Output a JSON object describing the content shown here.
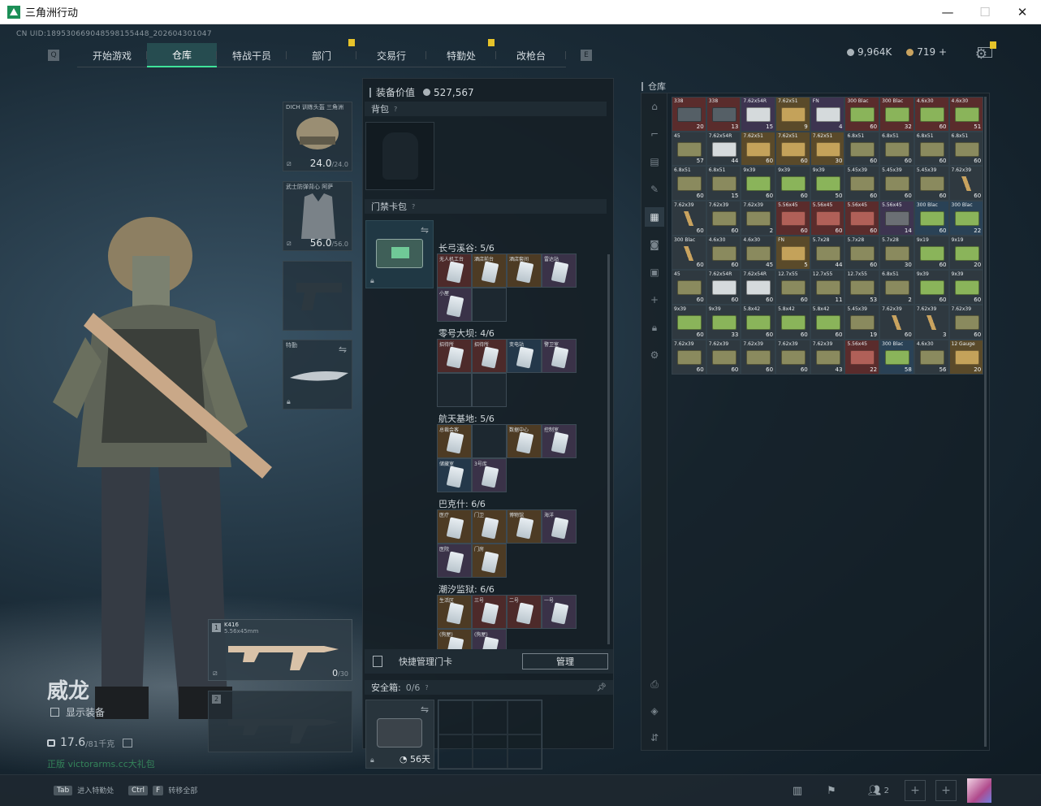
{
  "window": {
    "title": "三角洲行动",
    "minimize": "—",
    "maximize": "☐",
    "close": "✕"
  },
  "uid": "CN UID:1895306690485981554​48_202604301047",
  "nav": {
    "left_key": "Q",
    "right_key": "E",
    "tabs": [
      {
        "label": "开始游戏",
        "badge": false
      },
      {
        "label": "仓库",
        "badge": false,
        "active": true
      },
      {
        "label": "特战干员",
        "badge": false
      },
      {
        "label": "部门",
        "badge": true
      },
      {
        "label": "交易行",
        "badge": false
      },
      {
        "label": "特勤处",
        "badge": true
      },
      {
        "label": "改枪台",
        "badge": false
      }
    ]
  },
  "currency": {
    "silver": "9,964K",
    "gold": "719 +"
  },
  "player": {
    "name": "威龙",
    "show_equipment": "显示装备",
    "weight": "17.6",
    "weight_max": "/81千克",
    "watermark": "正版 victorarms.cc大礼包"
  },
  "equip_slots": {
    "helmet": {
      "label": "DICH 训练头盔 三角洲",
      "value": "24.0",
      "max": "/24.0"
    },
    "armor": {
      "label": "武士防弹背心 阿萨",
      "value": "56.0",
      "max": "/56.0"
    },
    "melee": {
      "label": "特勤"
    },
    "primary": {
      "num": "1",
      "name": "K416",
      "caliber": "5.56x45mm",
      "ammo": "0",
      "ammo_max": "/30"
    },
    "secondary": {
      "num": "2"
    }
  },
  "equip_panel": {
    "value_label": "装备价值",
    "value": "527,567",
    "backpack_label": "背包",
    "keycard_label": "门禁卡包",
    "maps": [
      {
        "label": "长弓溪谷: 5/6",
        "cards": [
          {
            "t": "无人机工台",
            "c": "red"
          },
          {
            "t": "酒店前台",
            "c": "gold"
          },
          {
            "t": "酒店套间",
            "c": "gold"
          },
          {
            "t": "雷达站",
            "c": "purple"
          },
          {
            "t": "小屋",
            "c": "purple"
          },
          {
            "t": "",
            "c": "empty"
          }
        ]
      },
      {
        "label": "零号大坝: 4/6",
        "cards": [
          {
            "t": "招待所",
            "c": "red"
          },
          {
            "t": "招待所",
            "c": "red"
          },
          {
            "t": "变电站",
            "c": "blue"
          },
          {
            "t": "警卫室",
            "c": "purple"
          },
          {
            "t": "",
            "c": "empty"
          },
          {
            "t": "",
            "c": "empty"
          }
        ]
      },
      {
        "label": "航天基地: 5/6",
        "cards": [
          {
            "t": "总裁会客",
            "c": "gold"
          },
          {
            "t": "",
            "c": "empty"
          },
          {
            "t": "数据中心",
            "c": "gold"
          },
          {
            "t": "控制室",
            "c": "purple"
          },
          {
            "t": "储藏室",
            "c": "blue"
          },
          {
            "t": "3号库",
            "c": "purple"
          }
        ]
      },
      {
        "label": "巴克什: 6/6",
        "cards": [
          {
            "t": "医疗",
            "c": "gold"
          },
          {
            "t": "门卫",
            "c": "gold"
          },
          {
            "t": "博物馆",
            "c": "gold"
          },
          {
            "t": "海洋",
            "c": "purple"
          },
          {
            "t": "医院",
            "c": "purple"
          },
          {
            "t": "门房",
            "c": "gold"
          }
        ]
      },
      {
        "label": "潮汐监狱: 6/6",
        "cards": [
          {
            "t": "生活区",
            "c": "gold"
          },
          {
            "t": "三号",
            "c": "red"
          },
          {
            "t": "二号",
            "c": "red"
          },
          {
            "t": "一号",
            "c": "purple"
          },
          {
            "t": "(狗屋)",
            "c": "gold"
          },
          {
            "t": "(狗屋)",
            "c": "purple"
          }
        ]
      }
    ],
    "quick_manage": "快捷管理门卡",
    "manage_button": "管理",
    "safebox_label": "安全箱:",
    "safebox_count": "0/6",
    "safebox_days": "56天"
  },
  "stash": {
    "title": "仓库",
    "items": [
      {
        "n": "338",
        "c": "20",
        "r": "red",
        "k": "dark"
      },
      {
        "n": "338",
        "c": "13",
        "r": "red",
        "k": "dark"
      },
      {
        "n": "7.62x54R",
        "c": "15",
        "r": "purple",
        "k": "white"
      },
      {
        "n": "7.62x51",
        "c": "9",
        "r": "gold",
        "k": "tan"
      },
      {
        "n": "FN",
        "c": "4",
        "r": "purple",
        "k": "white"
      },
      {
        "n": "300 Blac",
        "c": "60",
        "r": "red",
        "k": "green"
      },
      {
        "n": "300 Blac",
        "c": "32",
        "r": "red",
        "k": "green"
      },
      {
        "n": "4.6x30",
        "c": "60",
        "r": "red",
        "k": "green"
      },
      {
        "n": "4.6x30",
        "c": "51",
        "r": "red",
        "k": "green"
      },
      {
        "n": "45",
        "c": "57",
        "r": "gray",
        "k": "olive"
      },
      {
        "n": "7.62x54R",
        "c": "44",
        "r": "gray",
        "k": "white"
      },
      {
        "n": "7.62x51",
        "c": "60",
        "r": "gold",
        "k": "tan"
      },
      {
        "n": "7.62x51",
        "c": "60",
        "r": "gold",
        "k": "tan"
      },
      {
        "n": "7.62x51",
        "c": "30",
        "r": "gold",
        "k": "tan"
      },
      {
        "n": "6.8x51",
        "c": "60",
        "r": "gray",
        "k": "olive"
      },
      {
        "n": "6.8x51",
        "c": "60",
        "r": "gray",
        "k": "olive"
      },
      {
        "n": "6.8x51",
        "c": "60",
        "r": "gray",
        "k": "olive"
      },
      {
        "n": "6.8x51",
        "c": "60",
        "r": "gray",
        "k": "olive"
      },
      {
        "n": "6.8x51",
        "c": "60",
        "r": "gray",
        "k": "olive"
      },
      {
        "n": "6.8x51",
        "c": "15",
        "r": "gray",
        "k": "olive"
      },
      {
        "n": "9x39",
        "c": "60",
        "r": "gray",
        "k": "green"
      },
      {
        "n": "9x39",
        "c": "60",
        "r": "gray",
        "k": "green"
      },
      {
        "n": "9x39",
        "c": "50",
        "r": "gray",
        "k": "green"
      },
      {
        "n": "5.45x39",
        "c": "60",
        "r": "gray",
        "k": "olive"
      },
      {
        "n": "5.45x39",
        "c": "60",
        "r": "gray",
        "k": "olive"
      },
      {
        "n": "5.45x39",
        "c": "60",
        "r": "gray",
        "k": "olive"
      },
      {
        "n": "7.62x39",
        "c": "60",
        "r": "gray",
        "k": "round"
      },
      {
        "n": "7.62x39",
        "c": "60",
        "r": "gray",
        "k": "round"
      },
      {
        "n": "7.62x39",
        "c": "60",
        "r": "gray",
        "k": "olive"
      },
      {
        "n": "7.62x39",
        "c": "2",
        "r": "gray",
        "k": "olive"
      },
      {
        "n": "5.56x45",
        "c": "60",
        "r": "red",
        "k": "red"
      },
      {
        "n": "5.56x45",
        "c": "60",
        "r": "red",
        "k": "red"
      },
      {
        "n": "5.56x45",
        "c": "60",
        "r": "red",
        "k": "red"
      },
      {
        "n": "5.56x45",
        "c": "14",
        "r": "purple",
        "k": "mag"
      },
      {
        "n": "300 Blac",
        "c": "60",
        "r": "blue",
        "k": "green"
      },
      {
        "n": "300 Blac",
        "c": "22",
        "r": "blue",
        "k": "green"
      },
      {
        "n": "300 Blac",
        "c": "60",
        "r": "gray",
        "k": "round"
      },
      {
        "n": "4.6x30",
        "c": "60",
        "r": "gray",
        "k": "olive"
      },
      {
        "n": "4.6x30",
        "c": "45",
        "r": "gray",
        "k": "olive"
      },
      {
        "n": "FN",
        "c": "5",
        "r": "gold",
        "k": "tan"
      },
      {
        "n": "5.7x28",
        "c": "44",
        "r": "gray",
        "k": "olive"
      },
      {
        "n": "5.7x28",
        "c": "60",
        "r": "gray",
        "k": "olive"
      },
      {
        "n": "5.7x28",
        "c": "30",
        "r": "gray",
        "k": "olive"
      },
      {
        "n": "9x19",
        "c": "60",
        "r": "gray",
        "k": "green"
      },
      {
        "n": "9x19",
        "c": "20",
        "r": "gray",
        "k": "green"
      },
      {
        "n": "45",
        "c": "60",
        "r": "gray",
        "k": "olive"
      },
      {
        "n": "7.62x54R",
        "c": "60",
        "r": "gray",
        "k": "white"
      },
      {
        "n": "7.62x54R",
        "c": "60",
        "r": "gray",
        "k": "white"
      },
      {
        "n": "12.7x55",
        "c": "60",
        "r": "gray",
        "k": "olive"
      },
      {
        "n": "12.7x55",
        "c": "11",
        "r": "gray",
        "k": "olive"
      },
      {
        "n": "12.7x55",
        "c": "53",
        "r": "gray",
        "k": "olive"
      },
      {
        "n": "6.8x51",
        "c": "2",
        "r": "gray",
        "k": "olive"
      },
      {
        "n": "9x39",
        "c": "60",
        "r": "gray",
        "k": "green"
      },
      {
        "n": "9x39",
        "c": "60",
        "r": "gray",
        "k": "green"
      },
      {
        "n": "9x39",
        "c": "60",
        "r": "gray",
        "k": "green"
      },
      {
        "n": "9x39",
        "c": "33",
        "r": "gray",
        "k": "green"
      },
      {
        "n": "5.8x42",
        "c": "60",
        "r": "gray",
        "k": "green"
      },
      {
        "n": "5.8x42",
        "c": "60",
        "r": "gray",
        "k": "green"
      },
      {
        "n": "5.8x42",
        "c": "60",
        "r": "gray",
        "k": "green"
      },
      {
        "n": "5.45x39",
        "c": "19",
        "r": "gray",
        "k": "olive"
      },
      {
        "n": "7.62x39",
        "c": "60",
        "r": "gray",
        "k": "round"
      },
      {
        "n": "7.62x39",
        "c": "3",
        "r": "gray",
        "k": "round"
      },
      {
        "n": "7.62x39",
        "c": "60",
        "r": "gray",
        "k": "olive"
      },
      {
        "n": "7.62x39",
        "c": "60",
        "r": "gray",
        "k": "olive"
      },
      {
        "n": "7.62x39",
        "c": "60",
        "r": "gray",
        "k": "olive"
      },
      {
        "n": "7.62x39",
        "c": "60",
        "r": "gray",
        "k": "olive"
      },
      {
        "n": "7.62x39",
        "c": "60",
        "r": "gray",
        "k": "olive"
      },
      {
        "n": "7.62x39",
        "c": "43",
        "r": "gray",
        "k": "olive"
      },
      {
        "n": "5.56x45",
        "c": "22",
        "r": "red",
        "k": "red"
      },
      {
        "n": "300 Blac",
        "c": "58",
        "r": "blue",
        "k": "green"
      },
      {
        "n": "4.6x30",
        "c": "56",
        "r": "gray",
        "k": "olive"
      },
      {
        "n": "12 Gauge",
        "c": "20",
        "r": "gold",
        "k": "tan"
      }
    ]
  },
  "bottom": {
    "hint1_key": "Tab",
    "hint1": "进入特勤处",
    "hint2_key1": "Ctrl",
    "hint2_key2": "F",
    "hint2": "转移全部",
    "team_count": "2"
  },
  "colors": {
    "accent": "#3fe39a",
    "badge": "#e6c32a"
  }
}
